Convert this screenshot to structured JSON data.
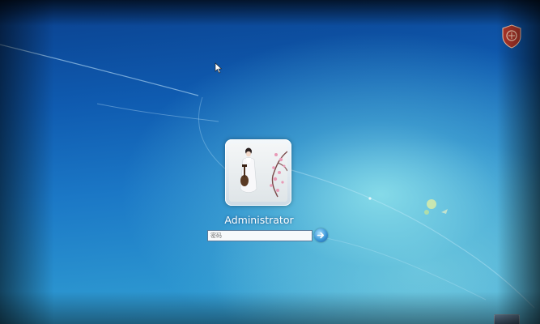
{
  "user": {
    "name": "Administrator",
    "avatar": "user-picture-woman-with-pipa-and-plum-blossoms"
  },
  "password": {
    "placeholder": "密码"
  },
  "icons": {
    "submit": "arrow-right-icon",
    "cursor": "mouse-pointer-icon",
    "corner": "shield-badge-icon",
    "accessibility": "ease-of-access-icon"
  },
  "colors": {
    "background_top": "#0a3f8c",
    "background_glow": "#8ce1eb",
    "submit_button": "#3b97d8",
    "text": "#ffffff"
  }
}
